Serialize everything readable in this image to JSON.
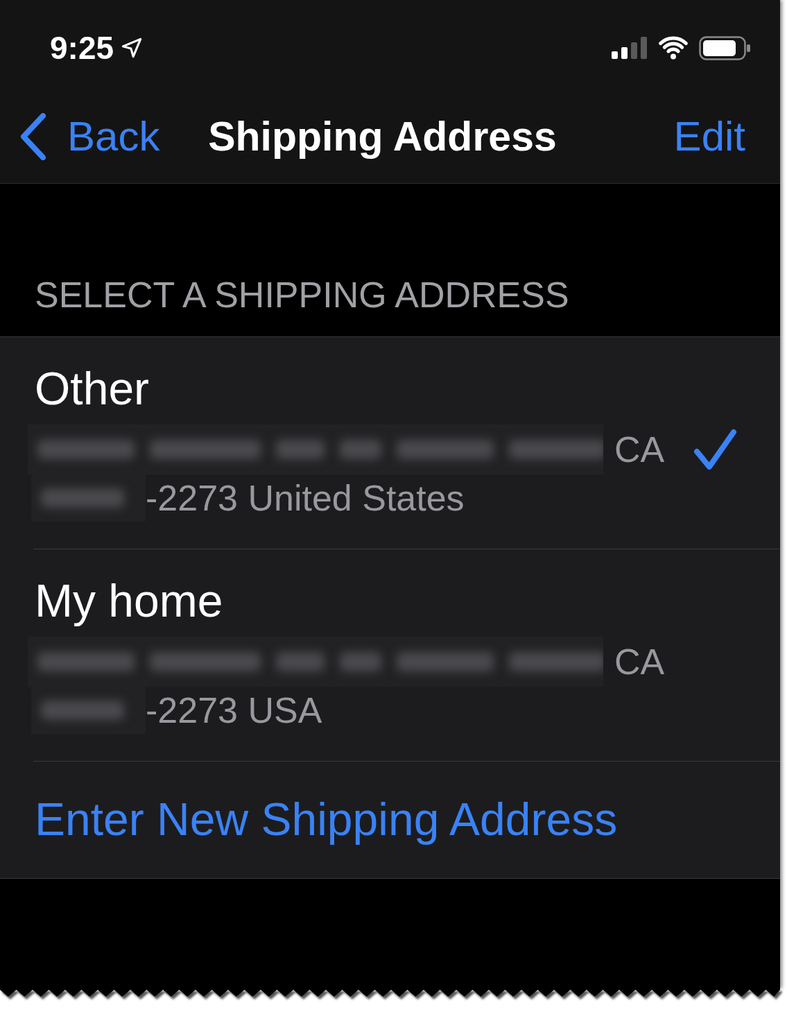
{
  "status_bar": {
    "time": "9:25"
  },
  "nav_bar": {
    "back_label": "Back",
    "title": "Shipping Address",
    "edit_label": "Edit"
  },
  "section_header": "SELECT A SHIPPING ADDRESS",
  "addresses": [
    {
      "name": "Other",
      "state": "CA",
      "zip_and_country": "-2273 United States",
      "selected": true
    },
    {
      "name": "My home",
      "state": "CA",
      "zip_and_country": "-2273 USA",
      "selected": false
    }
  ],
  "new_address_link": "Enter New Shipping Address"
}
